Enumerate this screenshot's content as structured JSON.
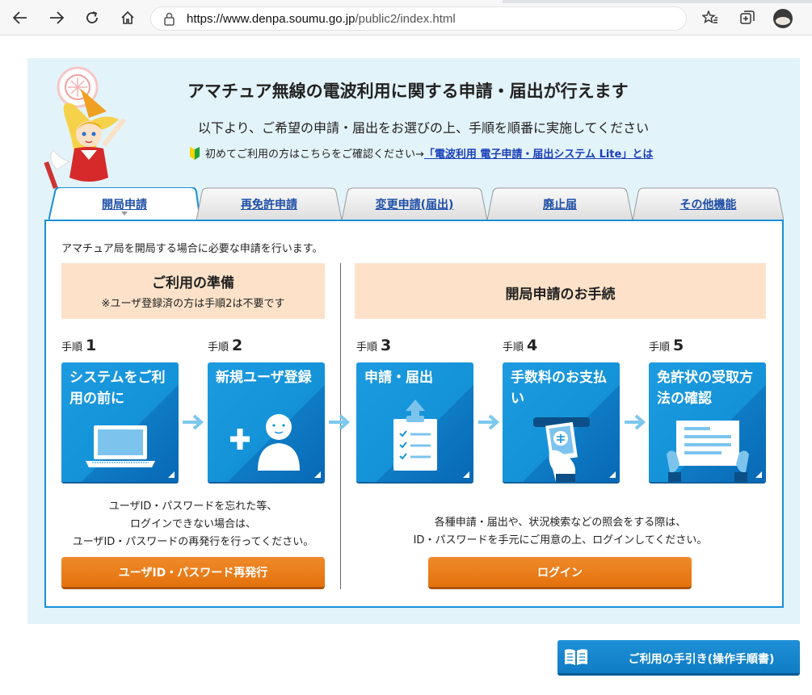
{
  "browser": {
    "url_prefix": "https://www.denpa.soumu.go.jp",
    "url_path": "/public2/index.html",
    "icons": [
      "back-icon",
      "forward-icon",
      "reload-icon",
      "home-icon",
      "lock-icon",
      "star-icon",
      "favorites-icon",
      "collections-icon",
      "profile-avatar"
    ]
  },
  "header": {
    "title": "アマチュア無線の電波利用に関する申請・届出が行えます",
    "subtitle": "以下より、ご希望の申請・届出をお選びの上、手順を順番に実施してください",
    "first_time_text": "初めてご利用の方はこちらをご確認ください→",
    "first_time_link": "「電波利用 電子申請・届出システム Lite」とは"
  },
  "tabs": [
    {
      "label": "開局申請",
      "active": true
    },
    {
      "label": "再免許申請",
      "active": false
    },
    {
      "label": "変更申請(届出)",
      "active": false
    },
    {
      "label": "廃止届",
      "active": false
    },
    {
      "label": "その他機能",
      "active": false
    }
  ],
  "panel": {
    "intro": "アマチュア局を開局する場合に必要な申請を行います。",
    "prep_title": "ご利用の準備",
    "prep_note": "※ユーザ登録済の方は手順2は不要です",
    "proc_title": "開局申請のお手続",
    "step_word": "手順",
    "steps": [
      {
        "num": "1",
        "title": "システムをご利用の前に",
        "icon": "laptop-icon"
      },
      {
        "num": "2",
        "title": "新規ユーザ登録",
        "icon": "add-user-icon"
      },
      {
        "num": "3",
        "title": "申請・届出",
        "icon": "checklist-upload-icon"
      },
      {
        "num": "4",
        "title": "手数料のお支払い",
        "icon": "atm-payment-icon"
      },
      {
        "num": "5",
        "title": "免許状の受取方法の確認",
        "icon": "license-certificate-icon"
      }
    ],
    "help_left": [
      "ユーザID・パスワードを忘れた等、",
      "ログインできない場合は、",
      "ユーザID・パスワードの再発行を行ってください。"
    ],
    "help_right": [
      "各種申請・届出や、状況検索などの照会をする際は、",
      "ID・パスワードを手元にご用意の上、ログインしてください。"
    ],
    "reissue_button": "ユーザID・パスワード再発行",
    "login_button": "ログイン"
  },
  "guide_button": "ご利用の手引き(操作手順書)",
  "colors": {
    "accent_blue": "#1a8fd8",
    "orange": "#e4720d",
    "peach": "#fde2c9",
    "light_bg": "#e3f3fa"
  }
}
